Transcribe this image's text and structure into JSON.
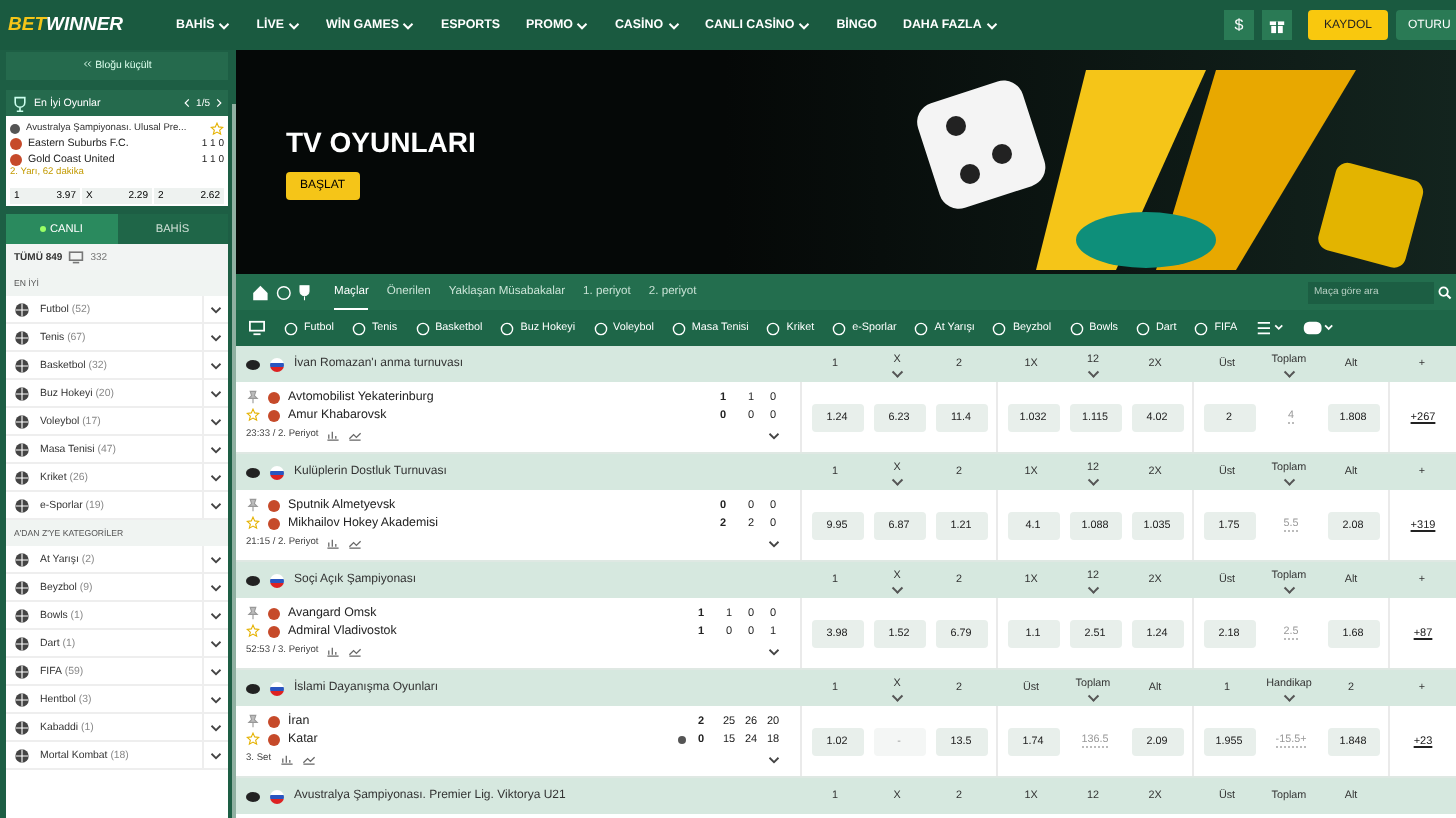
{
  "nav": {
    "logo_a": "BET",
    "logo_b": "WINNER",
    "items": [
      {
        "label": "BAHİS",
        "caret": true
      },
      {
        "label": "LİVE",
        "caret": true
      },
      {
        "label": "WİN GAMES",
        "caret": true
      },
      {
        "label": "ESPORTS",
        "caret": false
      },
      {
        "label": "PROMO",
        "caret": true
      },
      {
        "label": "CASİNO",
        "caret": true
      },
      {
        "label": "CANLI CASİNO",
        "caret": true
      },
      {
        "label": "BİNGO",
        "caret": false
      },
      {
        "label": "DAHA FAZLA",
        "caret": true
      }
    ],
    "currency": "$",
    "register": "KAYDOL",
    "login": "OTURU"
  },
  "sidebar": {
    "collapse": "Bloğu küçült",
    "top_games": {
      "title": "En İyi Oyunlar",
      "pager": "1/5",
      "league": "Avustralya Şampiyonası. Ulusal Pre...",
      "teams": [
        {
          "name": "Eastern Suburbs F.C.",
          "scores": [
            "1",
            "1",
            "0"
          ]
        },
        {
          "name": "Gold Coast United",
          "scores": [
            "1",
            "1",
            "0"
          ]
        }
      ],
      "status": "2. Yarı, 62 dakika",
      "odds": [
        {
          "label": "1",
          "value": "3.97"
        },
        {
          "label": "X",
          "value": "2.29"
        },
        {
          "label": "2",
          "value": "2.62"
        }
      ]
    },
    "tabs": [
      {
        "label": "CANLI",
        "selected": true
      },
      {
        "label": "BAHİS",
        "selected": false
      }
    ],
    "all_label": "TÜMÜ 849",
    "live_count": "332",
    "sections": [
      {
        "title": "EN İYİ",
        "sports": [
          {
            "name": "Futbol",
            "count": "(52)"
          },
          {
            "name": "Tenis",
            "count": "(67)"
          },
          {
            "name": "Basketbol",
            "count": "(32)"
          },
          {
            "name": "Buz Hokeyi",
            "count": "(20)"
          },
          {
            "name": "Voleybol",
            "count": "(17)"
          },
          {
            "name": "Masa Tenisi",
            "count": "(47)"
          },
          {
            "name": "Kriket",
            "count": "(26)"
          },
          {
            "name": "e-Sporlar",
            "count": "(19)"
          }
        ]
      },
      {
        "title": "A'DAN Z'YE KATEGORİLER",
        "sports": [
          {
            "name": "At Yarışı",
            "count": "(2)"
          },
          {
            "name": "Beyzbol",
            "count": "(9)"
          },
          {
            "name": "Bowls",
            "count": "(1)"
          },
          {
            "name": "Dart",
            "count": "(1)"
          },
          {
            "name": "FIFA",
            "count": "(59)"
          },
          {
            "name": "Hentbol",
            "count": "(3)"
          },
          {
            "name": "Kabaddi",
            "count": "(1)"
          },
          {
            "name": "Mortal Kombat",
            "count": "(18)"
          }
        ]
      }
    ]
  },
  "banner": {
    "title": "TV OYUNLARI",
    "button": "BAŞLAT"
  },
  "tabs": [
    {
      "label": "Maçlar",
      "selected": true
    },
    {
      "label": "Önerilen",
      "selected": false
    },
    {
      "label": "Yaklaşan Müsabakalar",
      "selected": false
    },
    {
      "label": "1. periyot",
      "selected": false
    },
    {
      "label": "2. periyot",
      "selected": false
    }
  ],
  "search": {
    "placeholder": "Maça göre ara"
  },
  "sports": [
    "Futbol",
    "Tenis",
    "Basketbol",
    "Buz Hokeyi",
    "Voleybol",
    "Masa Tenisi",
    "Kriket",
    "e-Sporlar",
    "At Yarışı",
    "Beyzbol",
    "Bowls",
    "Dart",
    "FIFA"
  ],
  "leagues": [
    {
      "name": "İvan Romazan'ı anma turnuvası",
      "columns": [
        {
          "label": "1",
          "caret": false
        },
        {
          "label": "X",
          "caret": true
        },
        {
          "label": "2",
          "caret": false
        },
        {
          "label": "1X",
          "caret": false
        },
        {
          "label": "12",
          "caret": true
        },
        {
          "label": "2X",
          "caret": false
        },
        {
          "label": "Üst",
          "caret": false
        },
        {
          "label": "Toplam",
          "caret": true
        },
        {
          "label": "Alt",
          "caret": false
        },
        {
          "label": "+",
          "caret": false
        }
      ],
      "matches": [
        {
          "teams": [
            {
              "name": "Avtomobilist Yekaterinburg",
              "serving": false,
              "scores": [
                "1",
                "1",
                "0"
              ]
            },
            {
              "name": "Amur Khabarovsk",
              "serving": false,
              "scores": [
                "0",
                "0",
                "0"
              ]
            }
          ],
          "time": "23:33 / 2. Periyot",
          "odds": [
            {
              "value": "1.24",
              "kind": "button"
            },
            {
              "value": "6.23",
              "kind": "button"
            },
            {
              "value": "11.4",
              "kind": "button"
            },
            {
              "value": "1.032",
              "kind": "button"
            },
            {
              "value": "1.115",
              "kind": "button"
            },
            {
              "value": "4.02",
              "kind": "button"
            },
            {
              "value": "2",
              "kind": "button"
            },
            {
              "value": "4",
              "kind": "plain"
            },
            {
              "value": "1.808",
              "kind": "button"
            }
          ],
          "more": "+267"
        }
      ]
    },
    {
      "name": "Kulüplerin Dostluk Turnuvası",
      "columns": [
        {
          "label": "1",
          "caret": false
        },
        {
          "label": "X",
          "caret": true
        },
        {
          "label": "2",
          "caret": false
        },
        {
          "label": "1X",
          "caret": false
        },
        {
          "label": "12",
          "caret": true
        },
        {
          "label": "2X",
          "caret": false
        },
        {
          "label": "Üst",
          "caret": false
        },
        {
          "label": "Toplam",
          "caret": true
        },
        {
          "label": "Alt",
          "caret": false
        },
        {
          "label": "+",
          "caret": false
        }
      ],
      "matches": [
        {
          "teams": [
            {
              "name": "Sputnik Almetyevsk",
              "serving": false,
              "scores": [
                "0",
                "0",
                "0"
              ]
            },
            {
              "name": "Mikhailov Hokey Akademisi",
              "serving": false,
              "scores": [
                "2",
                "2",
                "0"
              ]
            }
          ],
          "time": "21:15 / 2. Periyot",
          "odds": [
            {
              "value": "9.95",
              "kind": "button"
            },
            {
              "value": "6.87",
              "kind": "button"
            },
            {
              "value": "1.21",
              "kind": "button"
            },
            {
              "value": "4.1",
              "kind": "button"
            },
            {
              "value": "1.088",
              "kind": "button"
            },
            {
              "value": "1.035",
              "kind": "button"
            },
            {
              "value": "1.75",
              "kind": "button"
            },
            {
              "value": "5.5",
              "kind": "plain"
            },
            {
              "value": "2.08",
              "kind": "button"
            }
          ],
          "more": "+319"
        }
      ]
    },
    {
      "name": "Soçi Açık Şampiyonası",
      "columns": [
        {
          "label": "1",
          "caret": false
        },
        {
          "label": "X",
          "caret": true
        },
        {
          "label": "2",
          "caret": false
        },
        {
          "label": "1X",
          "caret": false
        },
        {
          "label": "12",
          "caret": true
        },
        {
          "label": "2X",
          "caret": false
        },
        {
          "label": "Üst",
          "caret": false
        },
        {
          "label": "Toplam",
          "caret": true
        },
        {
          "label": "Alt",
          "caret": false
        },
        {
          "label": "+",
          "caret": false
        }
      ],
      "matches": [
        {
          "teams": [
            {
              "name": "Avangard Omsk",
              "serving": false,
              "scores": [
                "1",
                "1",
                "0",
                "0"
              ]
            },
            {
              "name": "Admiral Vladivostok",
              "serving": false,
              "scores": [
                "1",
                "0",
                "0",
                "1"
              ]
            }
          ],
          "time": "52:53 / 3. Periyot",
          "odds": [
            {
              "value": "3.98",
              "kind": "button"
            },
            {
              "value": "1.52",
              "kind": "button"
            },
            {
              "value": "6.79",
              "kind": "button"
            },
            {
              "value": "1.1",
              "kind": "button"
            },
            {
              "value": "2.51",
              "kind": "button"
            },
            {
              "value": "1.24",
              "kind": "button"
            },
            {
              "value": "2.18",
              "kind": "button"
            },
            {
              "value": "2.5",
              "kind": "plain"
            },
            {
              "value": "1.68",
              "kind": "button"
            }
          ],
          "more": "+87"
        }
      ]
    },
    {
      "name": "İslami Dayanışma Oyunları",
      "columns": [
        {
          "label": "1",
          "caret": false
        },
        {
          "label": "X",
          "caret": true
        },
        {
          "label": "2",
          "caret": false
        },
        {
          "label": "Üst",
          "caret": false
        },
        {
          "label": "Toplam",
          "caret": true
        },
        {
          "label": "Alt",
          "caret": false
        },
        {
          "label": "1",
          "caret": false
        },
        {
          "label": "Handikap",
          "caret": true
        },
        {
          "label": "2",
          "caret": false
        },
        {
          "label": "+",
          "caret": false
        }
      ],
      "matches": [
        {
          "teams": [
            {
              "name": "İran",
              "serving": false,
              "scores": [
                "2",
                "25",
                "26",
                "20"
              ]
            },
            {
              "name": "Katar",
              "serving": true,
              "scores": [
                "0",
                "15",
                "24",
                "18"
              ]
            }
          ],
          "time": "3. Set",
          "odds": [
            {
              "value": "1.02",
              "kind": "button"
            },
            {
              "value": "-",
              "kind": "disabled"
            },
            {
              "value": "13.5",
              "kind": "button"
            },
            {
              "value": "1.74",
              "kind": "button"
            },
            {
              "value": "136.5",
              "kind": "plain"
            },
            {
              "value": "2.09",
              "kind": "button"
            },
            {
              "value": "1.955",
              "kind": "button"
            },
            {
              "value": "-15.5+",
              "kind": "plain"
            },
            {
              "value": "1.848",
              "kind": "button"
            }
          ],
          "more": "+23"
        }
      ]
    },
    {
      "name": "Avustralya Şampiyonası. Premier Lig. Viktorya U21",
      "columns": [
        {
          "label": "1",
          "caret": false
        },
        {
          "label": "X",
          "caret": false
        },
        {
          "label": "2",
          "caret": false
        },
        {
          "label": "1X",
          "caret": false
        },
        {
          "label": "12",
          "caret": false
        },
        {
          "label": "2X",
          "caret": false
        },
        {
          "label": "Üst",
          "caret": false
        },
        {
          "label": "Toplam",
          "caret": false
        },
        {
          "label": "Alt",
          "caret": false
        }
      ]
    }
  ]
}
